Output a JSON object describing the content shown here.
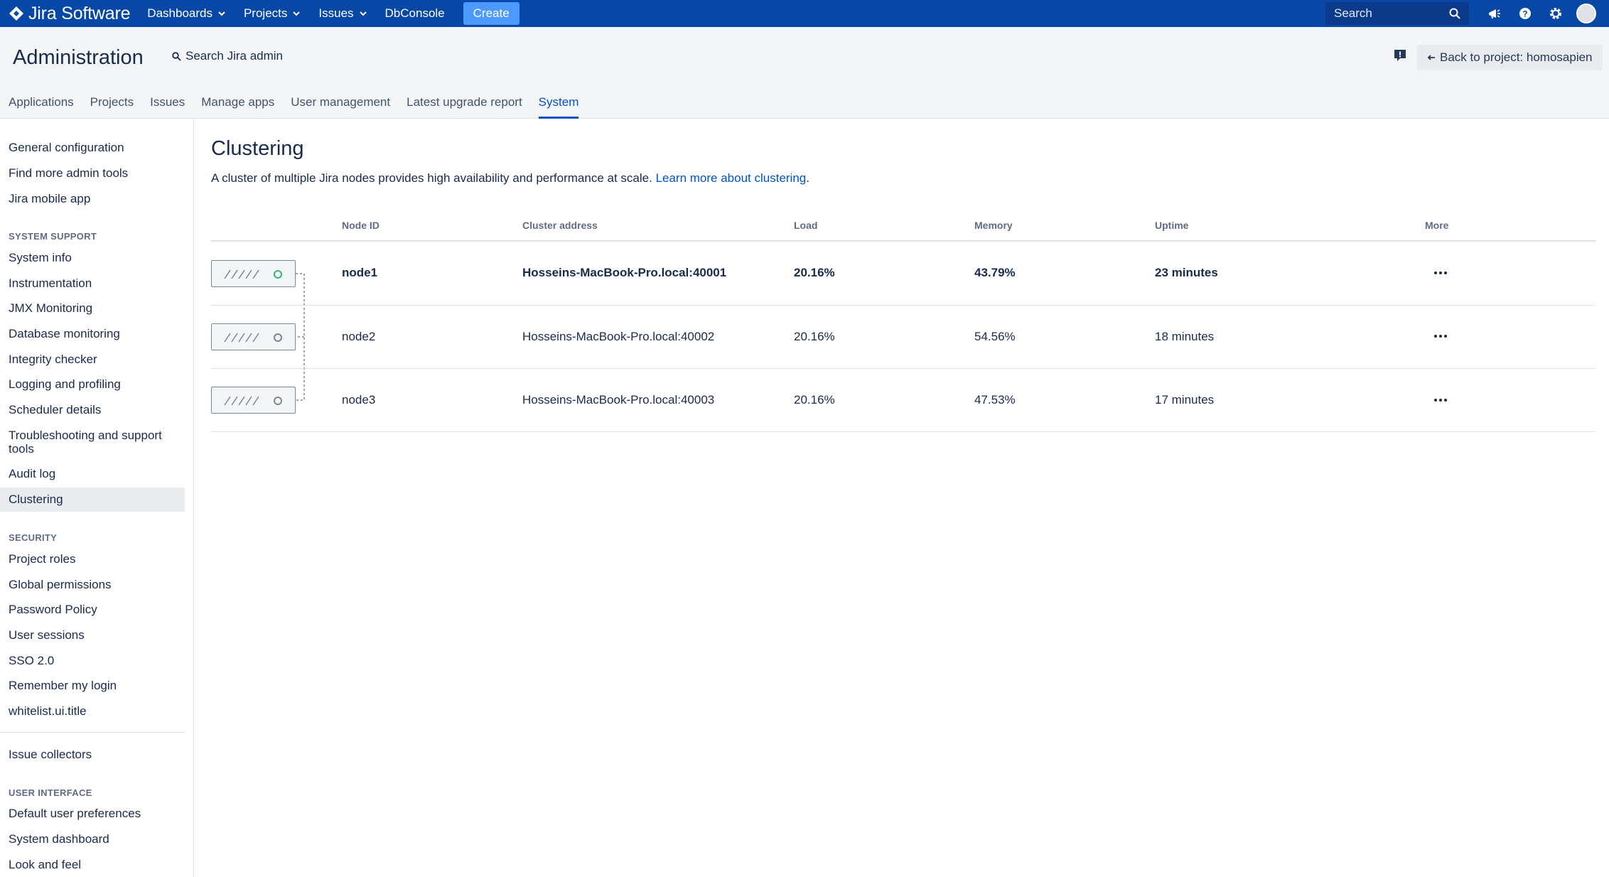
{
  "app": {
    "name": "Jira Software",
    "nav": [
      {
        "label": "Dashboards",
        "dropdown": true
      },
      {
        "label": "Projects",
        "dropdown": true
      },
      {
        "label": "Issues",
        "dropdown": true
      },
      {
        "label": "DbConsole",
        "dropdown": false
      }
    ],
    "create_label": "Create",
    "search_placeholder": "Search",
    "icons": [
      "notifications-icon",
      "help-icon",
      "settings-icon",
      "avatar"
    ]
  },
  "header": {
    "title": "Administration",
    "search_label": "Search Jira admin",
    "back_label": "Back to project: homosapien",
    "tabs": [
      {
        "label": "Applications"
      },
      {
        "label": "Projects"
      },
      {
        "label": "Issues"
      },
      {
        "label": "Manage apps"
      },
      {
        "label": "User management"
      },
      {
        "label": "Latest upgrade report"
      },
      {
        "label": "System",
        "active": true
      }
    ]
  },
  "sidebar": {
    "top_items": [
      "General configuration",
      "Find more admin tools",
      "Jira mobile app"
    ],
    "system_support_heading": "SYSTEM SUPPORT",
    "system_support_items": [
      "System info",
      "Instrumentation",
      "JMX Monitoring",
      "Database monitoring",
      "Integrity checker",
      "Logging and profiling",
      "Scheduler details",
      "Troubleshooting and support tools",
      "Audit log",
      "Clustering"
    ],
    "selected": "Clustering",
    "security_heading": "SECURITY",
    "security_items": [
      "Project roles",
      "Global permissions",
      "Password Policy",
      "User sessions",
      "SSO 2.0",
      "Remember my login",
      "whitelist.ui.title"
    ],
    "other_items": [
      "Issue collectors"
    ],
    "user_interface_heading": "USER INTERFACE",
    "user_interface_items": [
      "Default user preferences",
      "System dashboard",
      "Look and feel"
    ]
  },
  "main": {
    "title": "Clustering",
    "intro_text": "A cluster of multiple Jira nodes provides high availability and performance at scale.",
    "intro_link": "Learn more about clustering",
    "intro_end": ".",
    "columns": [
      "Node ID",
      "Cluster address",
      "Load",
      "Memory",
      "Uptime",
      "More"
    ],
    "nodes": [
      {
        "id": "node1",
        "address": "Hosseins-MacBook-Pro.local:40001",
        "load": "20.16%",
        "memory": "43.79%",
        "uptime": "23 minutes",
        "current": true
      },
      {
        "id": "node2",
        "address": "Hosseins-MacBook-Pro.local:40002",
        "load": "20.16%",
        "memory": "54.56%",
        "uptime": "18 minutes",
        "current": false
      },
      {
        "id": "node3",
        "address": "Hosseins-MacBook-Pro.local:40003",
        "load": "20.16%",
        "memory": "47.53%",
        "uptime": "17 minutes",
        "current": false
      }
    ]
  },
  "colors": {
    "topbar": "#0747a6",
    "create": "#4c9aff",
    "link": "#0052cc",
    "online": "#36b37e"
  }
}
